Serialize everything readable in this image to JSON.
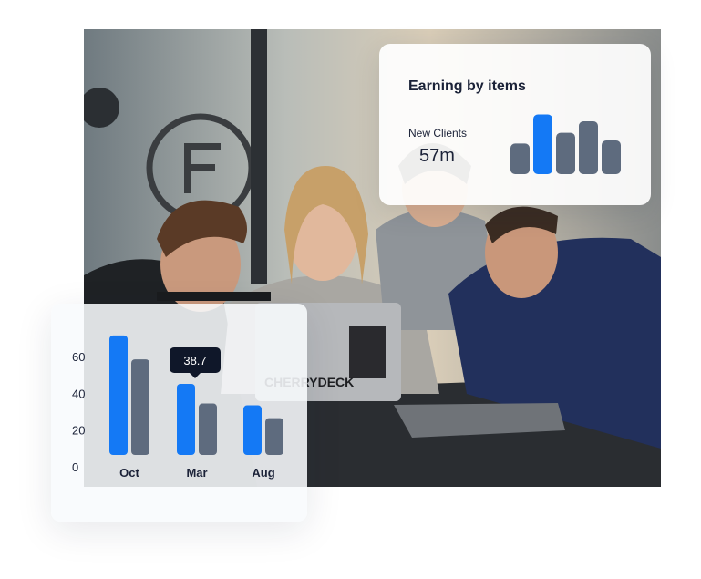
{
  "photo": {
    "alt": "Four people looking at a laptop at a meeting table",
    "laptop_sticker_text": "CHERRYDECK"
  },
  "earning_card": {
    "title": "Earning by items",
    "subtitle": "New Clients",
    "value": "57m",
    "mini_bars": [
      0.4,
      0.78,
      0.54,
      0.69,
      0.44
    ],
    "mini_bar_colors": [
      "#5e6b7e",
      "#1479f5",
      "#5e6b7e",
      "#5e6b7e",
      "#5e6b7e"
    ]
  },
  "colors": {
    "accent": "#1479f5",
    "secondary": "#5e6b7e",
    "text": "#1b2238",
    "tooltip_bg": "#0f1729"
  },
  "chart_data": {
    "type": "bar",
    "categories": [
      "Oct",
      "Mar",
      "Aug"
    ],
    "series": [
      {
        "values": [
          65,
          38.7,
          27
        ]
      },
      {
        "values": [
          52,
          28,
          20
        ]
      }
    ],
    "yticks": [
      0,
      20,
      40,
      60
    ],
    "ylim": [
      0,
      70
    ],
    "tooltip": {
      "category": "Mar",
      "label": "38.7"
    },
    "grid": false
  }
}
